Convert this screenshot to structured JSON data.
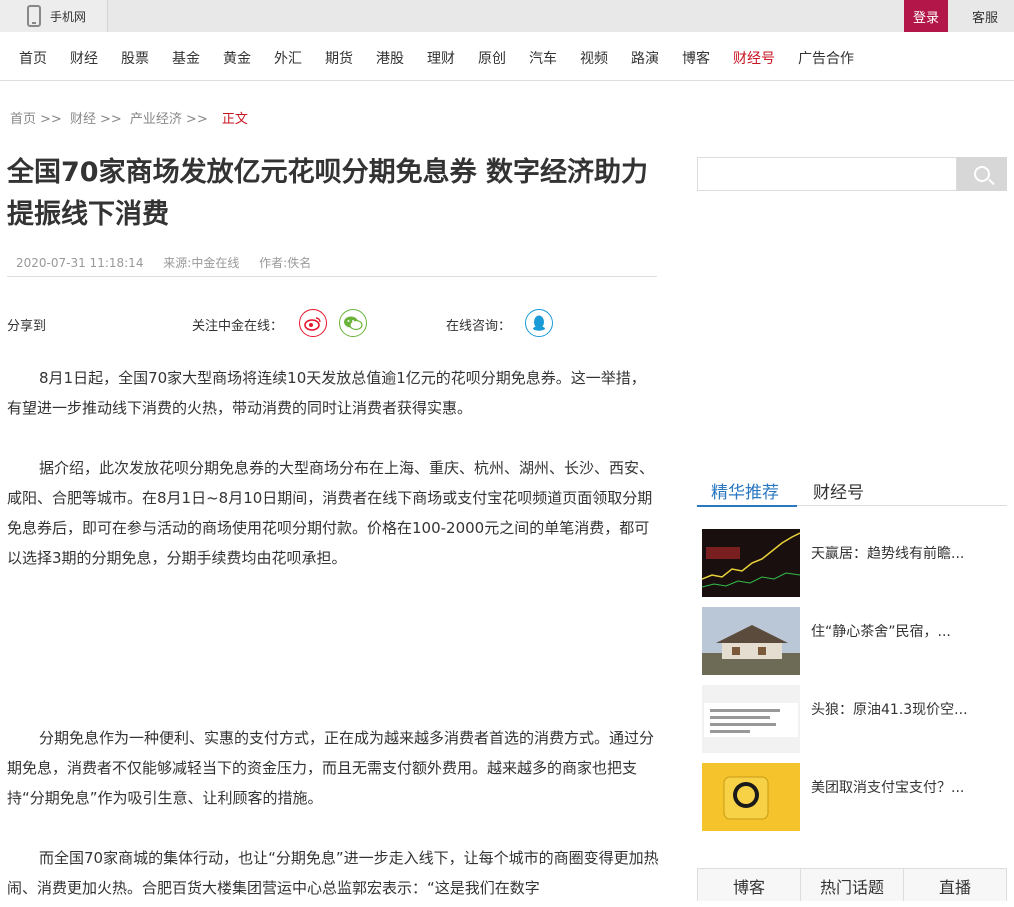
{
  "topbar": {
    "mobile": "手机网",
    "login": "登录",
    "service": "客服"
  },
  "nav": [
    "首页",
    "财经",
    "股票",
    "基金",
    "黄金",
    "外汇",
    "期货",
    "港股",
    "理财",
    "原创",
    "汽车",
    "视频",
    "路演",
    "博客",
    "财经号",
    "广告合作"
  ],
  "breadcrumb": {
    "home": "首页",
    "sep": ">>",
    "finance": "财经",
    "industry": "产业经济",
    "current": "正文"
  },
  "article": {
    "title": "全国70家商场发放亿元花呗分期免息券 数字经济助力提振线下消费",
    "date": "2020-07-31 11:18:14",
    "source": "来源:中金在线",
    "author": "作者:佚名",
    "share_label": "分享到",
    "follow_label": "关注中金在线：",
    "consult_label": "在线咨询：",
    "p1": "8月1日起，全国70家大型商场将连续10天发放总值逾1亿元的花呗分期免息券。这一举措，有望进一步推动线下消费的火热，带动消费的同时让消费者获得实惠。",
    "p2": "据介绍，此次发放花呗分期免息券的大型商场分布在上海、重庆、杭州、湖州、长沙、西安、咸阳、合肥等城市。在8月1日~8月10日期间，消费者在线下商场或支付宝花呗频道页面领取分期免息券后，即可在参与活动的商场使用花呗分期付款。价格在100-2000元之间的单笔消费，都可以选择3期的分期免息，分期手续费均由花呗承担。",
    "p3": "分期免息作为一种便利、实惠的支付方式，正在成为越来越多消费者首选的消费方式。通过分期免息，消费者不仅能够减轻当下的资金压力，而且无需支付额外费用。越来越多的商家也把支持“分期免息”作为吸引生意、让利顾客的措施。",
    "p4": "而全国70家商城的集体行动，也让“分期免息”进一步走入线下，让每个城市的商圈变得更加热闹、消费更加火热。合肥百货大楼集团营运中心总监郭宏表示：“这是我们在数字"
  },
  "sidebar": {
    "tabs": [
      "精华推荐",
      "财经号"
    ],
    "items": [
      "天赢居：趋势线有前瞻...",
      "住“静心茶舍”民宿，...",
      "头狼：原油41.3现价空...",
      "美团取消支付宝支付？..."
    ],
    "bottom_tabs": [
      "博客",
      "热门话题",
      "直播"
    ]
  }
}
